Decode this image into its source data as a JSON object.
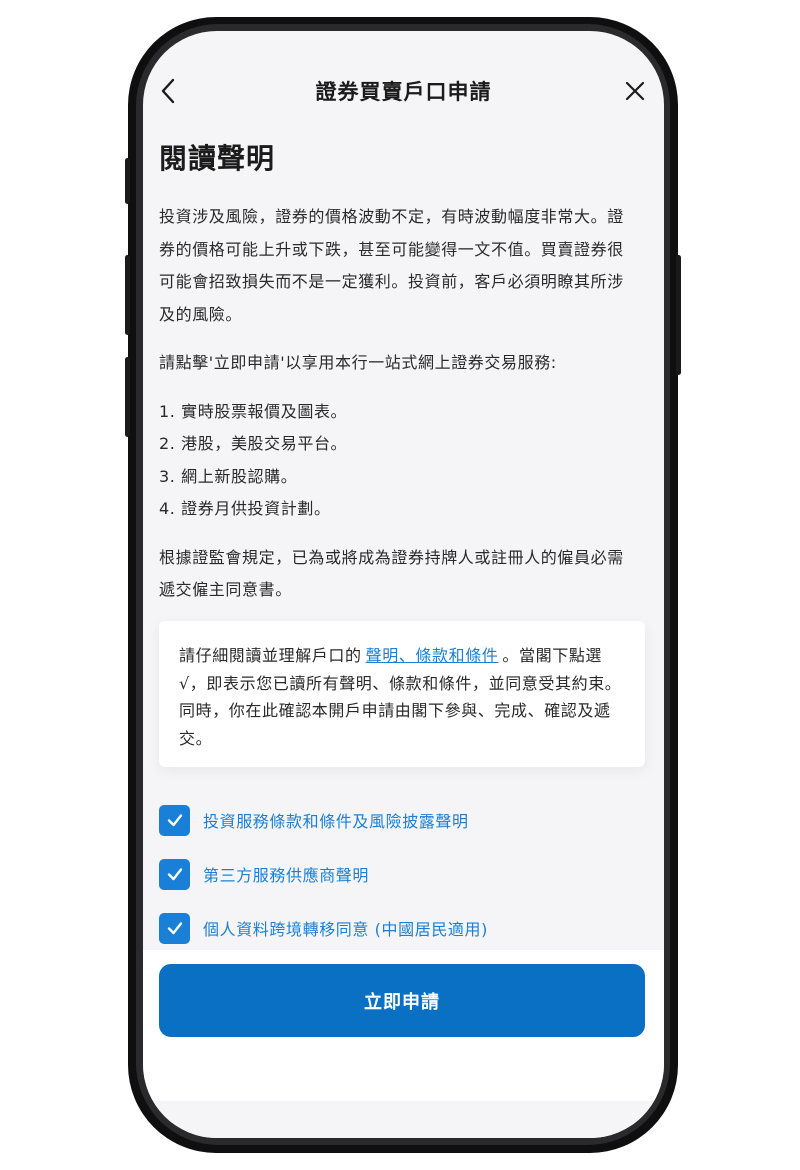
{
  "header": {
    "title": "證券買賣戶口申請"
  },
  "main": {
    "heading": "閱讀聲明",
    "paragraph1": "投資涉及風險，證券的價格波動不定，有時波動幅度非常大。證券的價格可能上升或下跌，甚至可能變得一文不值。買賣證券很可能會招致損失而不是一定獲利。投資前，客戶必須明瞭其所涉及的風險。",
    "paragraph2": "請點擊'立即申請'以享用本行一站式網上證券交易服務:",
    "list": [
      "1. 實時股票報價及圖表。",
      "2. 港股，美股交易平台。",
      "3. 網上新股認購。",
      "4. 證券月供投資計劃。"
    ],
    "paragraph3": "根據證監會規定，已為或將成為證券持牌人或註冊人的僱員必需遞交僱主同意書。"
  },
  "notice": {
    "text_before": "請仔細閱讀並理解戶口的",
    "link": "聲明、條款和條件",
    "text_after": "。當閣下點選√，即表示您已讀所有聲明、條款和條件，並同意受其約束。同時，你在此確認本開戶申請由閣下參與、完成、確認及遞交。"
  },
  "checkboxes": [
    {
      "label": "投資服務條款和條件及風險披露聲明",
      "checked": true
    },
    {
      "label": "第三方服務供應商聲明",
      "checked": true
    },
    {
      "label": "個人資料跨境轉移同意 (中國居民適用)",
      "checked": true
    }
  ],
  "actions": {
    "apply_label": "立即申請"
  },
  "colors": {
    "accent": "#1a7fd6",
    "button": "#0a70c4",
    "background": "#f5f5f7",
    "text": "#2a2a2a"
  },
  "icons": {
    "back": "chevron-left-icon",
    "close": "close-icon",
    "check": "checkmark-icon"
  }
}
